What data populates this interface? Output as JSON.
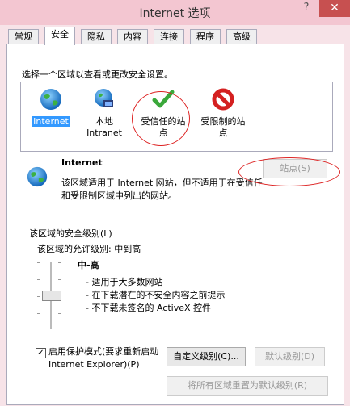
{
  "window": {
    "title": "Internet 选项",
    "help": "?",
    "close": "✕"
  },
  "tabs": [
    "常规",
    "安全",
    "隐私",
    "内容",
    "连接",
    "程序",
    "高级"
  ],
  "active_tab_index": 1,
  "zone_prompt": "选择一个区域以查看或更改安全设置。",
  "zones": [
    {
      "line1": "Internet",
      "line2": "",
      "icon": "globe-icon",
      "selected": true
    },
    {
      "line1": "本地",
      "line2": "Intranet",
      "icon": "intranet-globe-icon",
      "selected": false
    },
    {
      "line1": "受信任的站",
      "line2": "点",
      "icon": "checkmark-icon",
      "selected": false
    },
    {
      "line1": "受限制的站",
      "line2": "点",
      "icon": "restricted-icon",
      "selected": false
    }
  ],
  "zone_info": {
    "title": "Internet",
    "desc_line1": "该区域适用于 Internet 网站，但不适用于在受信任",
    "desc_line2": "和受限制区域中列出的网站。",
    "sites_button": "站点(S)"
  },
  "security_level": {
    "group_title": "该区域的安全级别(L)",
    "allowed": "该区域的允许级别: 中到高",
    "level_name": "中-高",
    "bullets": [
      "- 适用于大多数网站",
      "- 在下载潜在的不安全内容之前提示",
      "- 不下载未签名的 ActiveX 控件"
    ],
    "protected_mode_line1": "启用保护模式(要求重新启动",
    "protected_mode_line2": "Internet Explorer)(P)",
    "protected_mode_checked": true,
    "check_mark": "✓",
    "custom_button": "自定义级别(C)...",
    "default_button": "默认级别(D)",
    "reset_all_button": "将所有区域重置为默认级别(R)"
  }
}
